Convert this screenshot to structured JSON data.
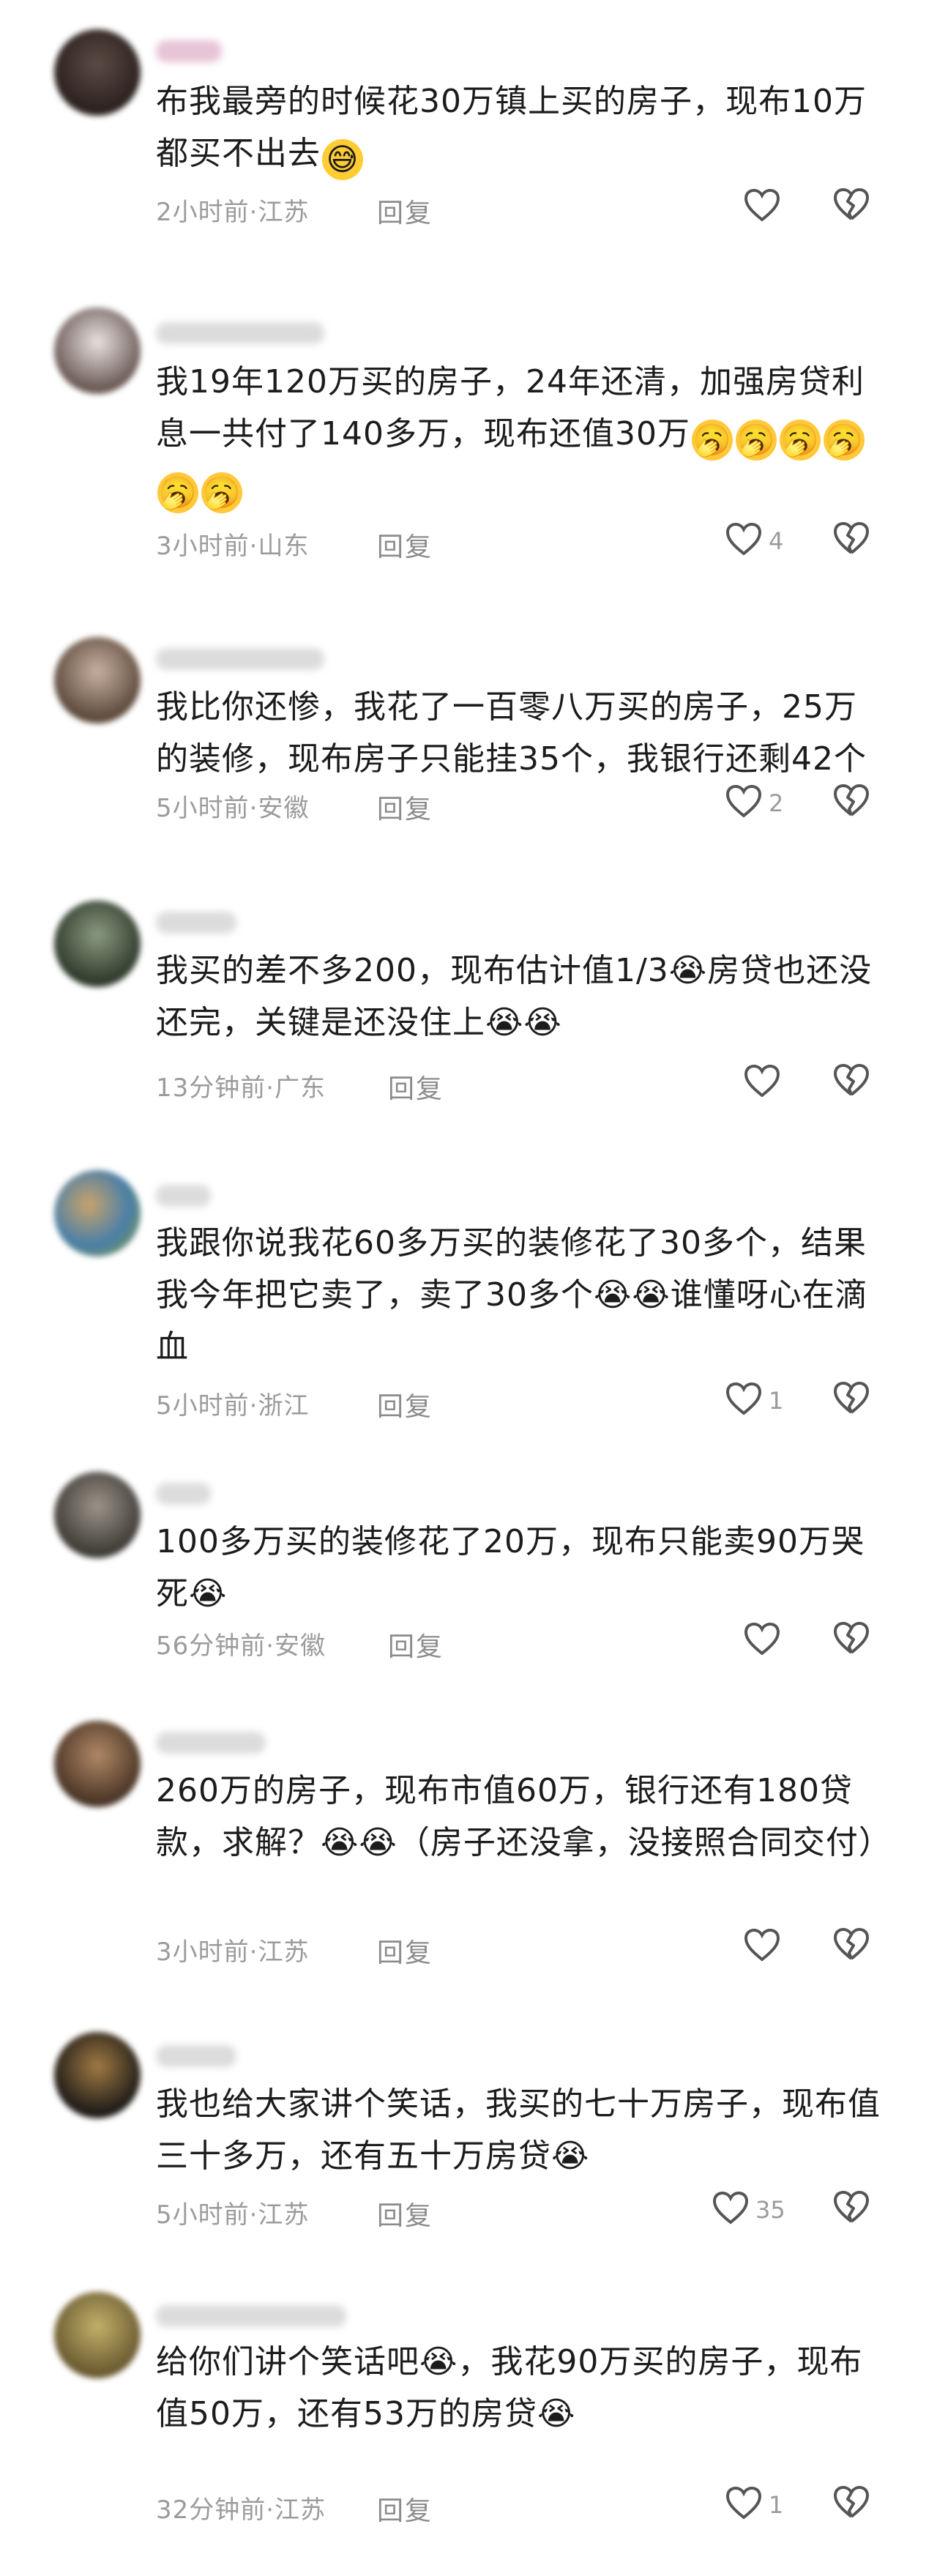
{
  "comments": [
    {
      "text": "布我最旁的时候花30万镇上买的房子，现布10万都买不出去",
      "emoji": "sweat",
      "emoji_count": 1,
      "time_location": "2小时前·江苏",
      "reply_label": "回复",
      "like_count": "",
      "avatar_color": "#3b2f2b"
    },
    {
      "text": "我19年120万买的房子，24年还清，加强房贷利息一共付了140多万，现布还值30万",
      "emoji": "yawn",
      "emoji_count": 6,
      "time_location": "3小时前·山东",
      "reply_label": "回复",
      "like_count": "4",
      "avatar_color": "#6b5a55"
    },
    {
      "text": "我比你还惨，我花了一百零八万买的房子，25万的装修，现布房子只能挂35个，我银行还剩42个",
      "emoji": "",
      "emoji_count": 0,
      "time_location": "5小时前·安徽",
      "reply_label": "回复",
      "like_count": "2",
      "avatar_color": "#5d4a3c"
    },
    {
      "text": "我买的差不多200，现布估计值1/3😭房贷也还没还完，关键是还没住上😭😭",
      "emoji": "",
      "emoji_count": 0,
      "time_location": "13分钟前·广东",
      "reply_label": "回复",
      "like_count": "",
      "avatar_color": "#3e4a3b"
    },
    {
      "text": "我跟你说我花60多万买的装修花了30多个，结果我今年把它卖了，卖了30多个😭😭谁懂呀心在滴血",
      "emoji": "",
      "emoji_count": 0,
      "time_location": "5小时前·浙江",
      "reply_label": "回复",
      "like_count": "1",
      "avatar_color": "#6b8f6a"
    },
    {
      "text": "100多万买的装修花了20万，现布只能卖90万哭死😭",
      "emoji": "",
      "emoji_count": 0,
      "time_location": "56分钟前·安徽",
      "reply_label": "回复",
      "like_count": "",
      "avatar_color": "#55524a"
    },
    {
      "text": "260万的房子，现布市值60万，银行还有180贷款，求解？😭😭（房子还没拿，没接照合同交付）",
      "emoji": "",
      "emoji_count": 0,
      "time_location": "3小时前·江苏",
      "reply_label": "回复",
      "like_count": "",
      "avatar_color": "#5b4534"
    },
    {
      "text": "我也给大家讲个笑话，我买的七十万房子，现布值三十多万，还有五十万房贷😭",
      "emoji": "",
      "emoji_count": 0,
      "time_location": "5小时前·江苏",
      "reply_label": "回复",
      "like_count": "35",
      "avatar_color": "#2c2924"
    },
    {
      "text": "给你们讲个笑话吧😭，我花90万买的房子，现布值50万，还有53万的房贷😭",
      "emoji": "",
      "emoji_count": 0,
      "time_location": "32分钟前·江苏",
      "reply_label": "回复",
      "like_count": "1",
      "avatar_color": "#7a6a3e"
    }
  ],
  "icons": {
    "like": "heart-outline-icon",
    "dislike": "broken-heart-icon"
  },
  "colors": {
    "meta_text": "#9b9b9b",
    "body_text": "#1c1c1c",
    "icon_stroke": "#555555"
  }
}
